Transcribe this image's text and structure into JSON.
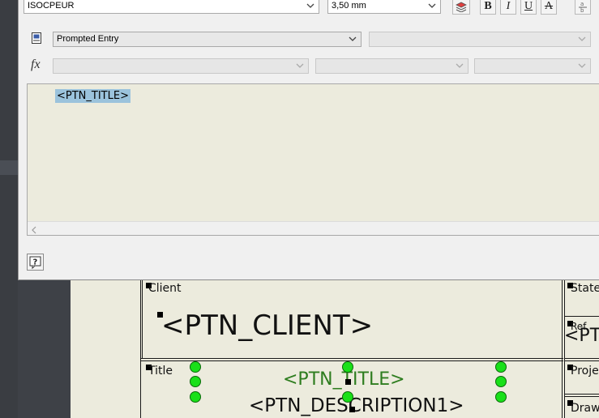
{
  "toolbar": {
    "text_style": "ISOCPEUR",
    "text_height": "3,50 mm",
    "bold_label": "B",
    "italic_label": "I",
    "underline_label": "U",
    "strike_label": "A"
  },
  "field": {
    "category": "Prompted Entry",
    "function_symbol": "fx"
  },
  "editor": {
    "text": "<PTN_TITLE>"
  },
  "drawing": {
    "client_label": "Client",
    "client_value": "<PTN_CLIENT>",
    "title_label": "Title",
    "title_value": "<PTN_TITLE>",
    "description_value": "<PTN_DESCRIPTION1>",
    "state_label": "State",
    "ref_label": "Ref",
    "ref_value": "<PT",
    "project_label": "Proje",
    "drawing_label": "Draw"
  },
  "colors": {
    "selection": "#9bc3dc",
    "grip_green": "#19e019",
    "attribute_text": "#2e7d1f",
    "canvas": "#ecebdd"
  }
}
